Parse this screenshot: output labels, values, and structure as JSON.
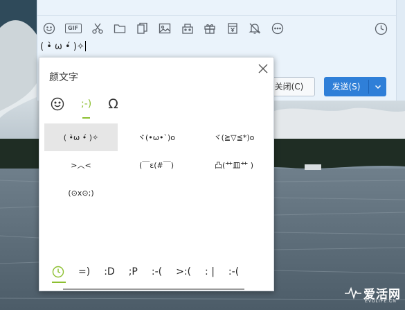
{
  "chat": {
    "input_text": "( •̀ ω •́ )✧",
    "close_label": "关闭(C)",
    "send_label": "发送(S)",
    "toolbar_icons": [
      "emoji-icon",
      "gif-icon",
      "scissors-icon",
      "folder-icon",
      "files-icon",
      "image-icon",
      "app-icon",
      "gift-icon",
      "voucher-icon",
      "bell-off-icon",
      "more-icon"
    ],
    "gif_label": "GIF"
  },
  "popup": {
    "title": "颜文字",
    "categories": [
      {
        "label": "☺",
        "icon": "smiley-icon"
      },
      {
        "label": ";-)",
        "active": true
      },
      {
        "label": "Ω"
      }
    ],
    "kaomoji": [
      "( •̀ω •́ )✧",
      "ヾ(•ω•`)o",
      "ヾ(≧▽≦*)o",
      ">︿<",
      "(￣ε(#￣)",
      "凸(艹皿艹 )",
      "(⊙x⊙;)"
    ],
    "bottom_tabs": [
      "=)",
      ":D",
      ";P",
      ":-(",
      ">:(",
      ": |",
      ":-("
    ]
  },
  "watermark": {
    "cn": "爱活网",
    "en": "EVOLIFE.CN"
  },
  "colors": {
    "accent_green": "#8cbf2f",
    "send_blue": "#2f7fd8",
    "window_bg": "#eaf3fb"
  }
}
